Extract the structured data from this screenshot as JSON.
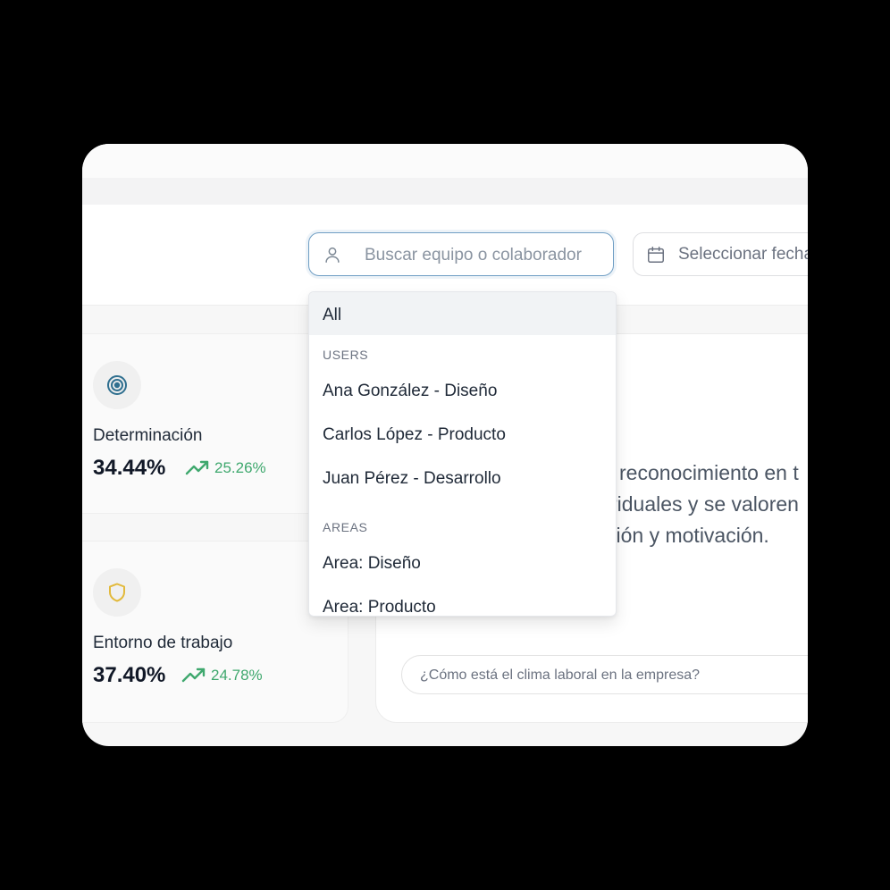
{
  "search": {
    "placeholder": "Buscar equipo o colaborador"
  },
  "date_picker": {
    "label": "Seleccionar fecha"
  },
  "dropdown": {
    "all_label": "All",
    "users_heading": "USERS",
    "users": [
      "Ana González - Diseño",
      "Carlos López - Producto",
      "Juan Pérez - Desarrollo"
    ],
    "areas_heading": "AREAS",
    "areas": [
      "Area: Diseño",
      "Area: Producto"
    ]
  },
  "cards": [
    {
      "title": "Determinación",
      "value": "34.44%",
      "delta": "25.26%",
      "icon": "target-icon"
    },
    {
      "title": "Entorno de trabajo",
      "value": "37.40%",
      "delta": "24.78%",
      "icon": "shield-icon"
    }
  ],
  "main_panel": {
    "text_lines": [
      "reconocimiento en t",
      "riduales y se valoren",
      "xión y motivación."
    ],
    "chat_placeholder": "¿Cómo está el clima laboral en la empresa?"
  },
  "colors": {
    "accent": "#6f9ec4",
    "positive": "#3fa86e",
    "target": "#2f6f8f",
    "shield": "#e2b93b"
  }
}
